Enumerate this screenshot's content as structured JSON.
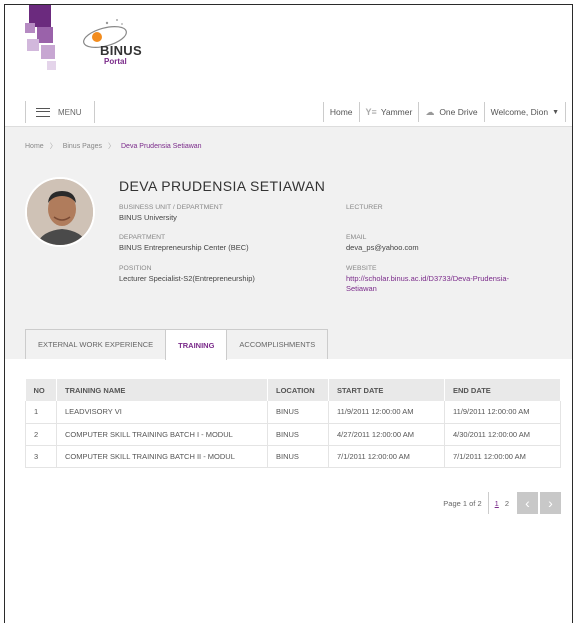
{
  "header": {
    "logo_text": "BINUS",
    "logo_sub": "Portal"
  },
  "nav": {
    "menu_label": "MENU",
    "items": [
      {
        "label": "Home"
      },
      {
        "label": "Yammer"
      },
      {
        "label": "One Drive"
      },
      {
        "label": "Welcome, Dion"
      }
    ]
  },
  "breadcrumb": [
    "Home",
    "Binus Pages",
    "Deva Prudensia Setiawan"
  ],
  "profile": {
    "name": "DEVA PRUDENSIA SETIAWAN",
    "business_unit_label": "BUSINESS UNIT / DEPARTMENT",
    "business_unit": "BINUS University",
    "department_label": "DEPARTMENT",
    "department": "BINUS Entrepreneurship Center (BEC)",
    "position_label": "POSITION",
    "position": "Lecturer Specialist-S2(Entrepreneurship)",
    "role_label": "LECTURER",
    "email_label": "EMAIL",
    "email": "deva_ps@yahoo.com",
    "website_label": "WEBSITE",
    "website_line1": "http://scholar.binus.ac.id/D3733/Deva-Prudensia-",
    "website_line2": "Setiawan"
  },
  "tabs": [
    {
      "label": "EXTERNAL WORK EXPERIENCE",
      "active": false
    },
    {
      "label": "TRAINING",
      "active": true
    },
    {
      "label": "ACCOMPLISHMENTS",
      "active": false
    }
  ],
  "table": {
    "headers": [
      "NO",
      "TRAINING NAME",
      "LOCATION",
      "START DATE",
      "END DATE"
    ],
    "rows": [
      [
        "1",
        "LEADVISORY VI",
        "BINUS",
        "11/9/2011 12:00:00 AM",
        "11/9/2011 12:00:00 AM"
      ],
      [
        "2",
        "COMPUTER SKILL TRAINING BATCH I - MODUL",
        "BINUS",
        "4/27/2011 12:00:00 AM",
        "4/30/2011 12:00:00 AM"
      ],
      [
        "3",
        "COMPUTER SKILL TRAINING BATCH II - MODUL",
        "BINUS",
        "7/1/2011 12:00:00 AM",
        "7/1/2011 12:00:00 AM"
      ]
    ]
  },
  "pagination": {
    "info": "Page 1 of 2",
    "page1": "1",
    "page2": "2",
    "prev_icon": "‹",
    "next_icon": "›"
  },
  "colors": {
    "accent": "#7a2a8a",
    "panel_bg": "#f1f1f1"
  }
}
